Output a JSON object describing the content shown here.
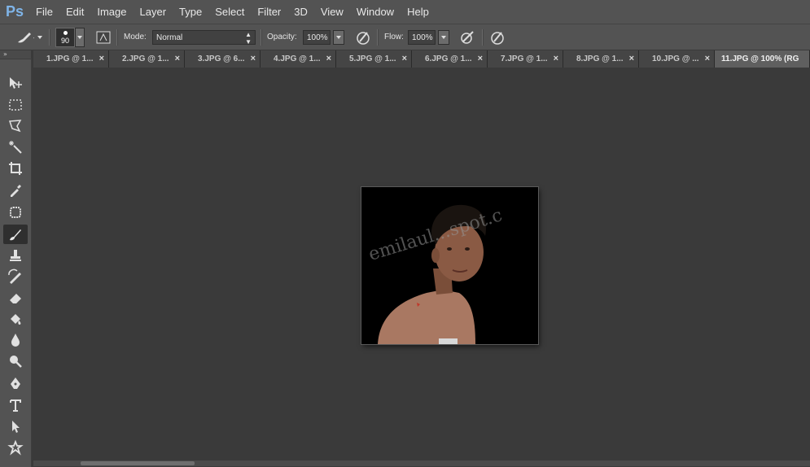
{
  "app": {
    "logo": "Ps"
  },
  "menu": [
    "File",
    "Edit",
    "Image",
    "Layer",
    "Type",
    "Select",
    "Filter",
    "3D",
    "View",
    "Window",
    "Help"
  ],
  "options": {
    "brush_size": "90",
    "mode_label": "Mode:",
    "mode_value": "Normal",
    "opacity_label": "Opacity:",
    "opacity_value": "100%",
    "flow_label": "Flow:",
    "flow_value": "100%"
  },
  "panel_collapse": "»",
  "tabs": [
    {
      "label": "1.JPG @ 1...",
      "close": "×"
    },
    {
      "label": "2.JPG @ 1...",
      "close": "×"
    },
    {
      "label": "3.JPG @ 6...",
      "close": "×"
    },
    {
      "label": "4.JPG @ 1...",
      "close": "×"
    },
    {
      "label": "5.JPG @ 1...",
      "close": "×"
    },
    {
      "label": "6.JPG @ 1...",
      "close": "×"
    },
    {
      "label": "7.JPG @ 1...",
      "close": "×"
    },
    {
      "label": "8.JPG @ 1...",
      "close": "×"
    },
    {
      "label": "10.JPG @ ...",
      "close": "×"
    },
    {
      "label": "11.JPG @ 100% (RG",
      "close": ""
    }
  ],
  "active_tab_index": 9,
  "document": {
    "watermark": "emilaul...spot.c"
  },
  "colors": {
    "accent": "#7fb4e8",
    "panel": "#535353",
    "workspace": "#3a3a3a"
  },
  "tools": [
    "move-icon",
    "marquee-icon",
    "lasso-icon",
    "magic-wand-icon",
    "crop-icon",
    "eyedropper-icon",
    "healing-brush-icon",
    "brush-icon",
    "clone-stamp-icon",
    "history-brush-icon",
    "eraser-icon",
    "gradient-icon",
    "blur-icon",
    "dodge-icon",
    "pen-icon",
    "type-icon",
    "path-selection-icon",
    "shape-icon"
  ],
  "selected_tool": "brush-icon"
}
